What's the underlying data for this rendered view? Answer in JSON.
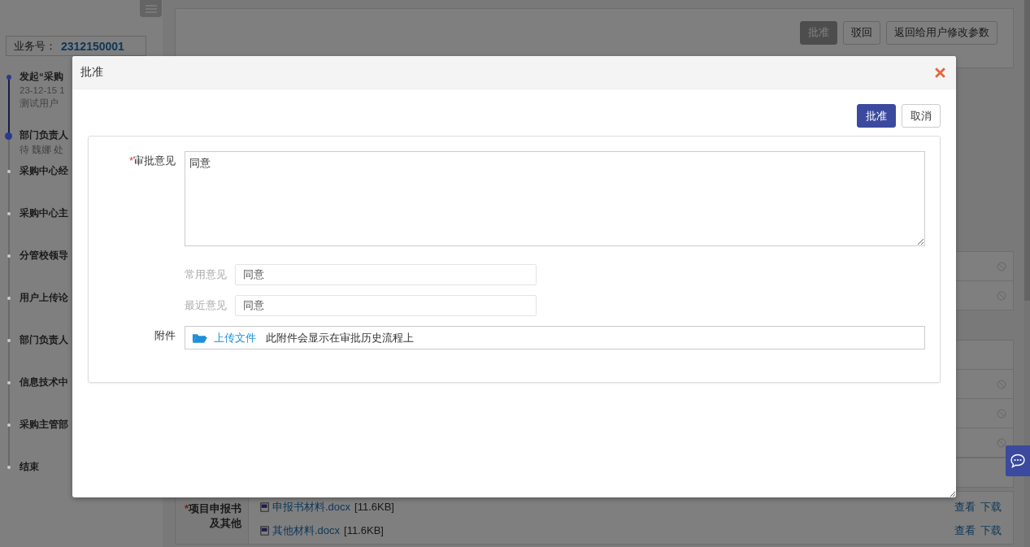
{
  "sidebar": {
    "business_no_label": "业务号：",
    "business_no": "2312150001",
    "steps": [
      {
        "title": "发起“采购",
        "lines": [
          "23-12-15 1",
          "测试用户"
        ],
        "completed": true,
        "current": false
      },
      {
        "title": "部门负责人",
        "lines": [
          "待 魏娜 处"
        ],
        "completed": false,
        "current": true
      },
      {
        "title": "采购中心经",
        "completed": false,
        "current": false
      },
      {
        "title": "采购中心主",
        "completed": false,
        "current": false
      },
      {
        "title": "分管校领导",
        "completed": false,
        "current": false
      },
      {
        "title": "用户上传论",
        "completed": false,
        "current": false
      },
      {
        "title": "部门负责人",
        "completed": false,
        "current": false
      },
      {
        "title": "信息技术中",
        "completed": false,
        "current": false
      },
      {
        "title": "采购主管部",
        "completed": false,
        "current": false
      },
      {
        "title": "结束",
        "completed": false,
        "current": false
      }
    ]
  },
  "toolbar": {
    "buttons": [
      {
        "label": "批准",
        "disabled": true
      },
      {
        "label": "驳回",
        "disabled": false
      },
      {
        "label": "返回给用户修改参数",
        "disabled": false
      }
    ]
  },
  "attachments": {
    "label": "项目申报书及其他",
    "required_mark": "*",
    "files": [
      {
        "name": "申报书材料.docx",
        "size": "[11.6KB]",
        "actions": [
          "查看",
          "下载"
        ]
      },
      {
        "name": "其他材料.docx",
        "size": "[11.6KB]",
        "actions": [
          "查看",
          "下载"
        ]
      }
    ]
  },
  "dialog": {
    "title": "批准",
    "buttons": [
      {
        "label": "批准",
        "kind": "primary"
      },
      {
        "label": "取消",
        "kind": "default"
      }
    ],
    "opinion": {
      "label": "审批意见",
      "required_mark": "*",
      "value": "同意"
    },
    "common": {
      "label": "常用意见",
      "value": "同意"
    },
    "recent": {
      "label": "最近意见",
      "value": "同意"
    },
    "attachment": {
      "label": "附件",
      "upload": "上传文件",
      "hint": "此附件会显示在审批历史流程上"
    }
  }
}
